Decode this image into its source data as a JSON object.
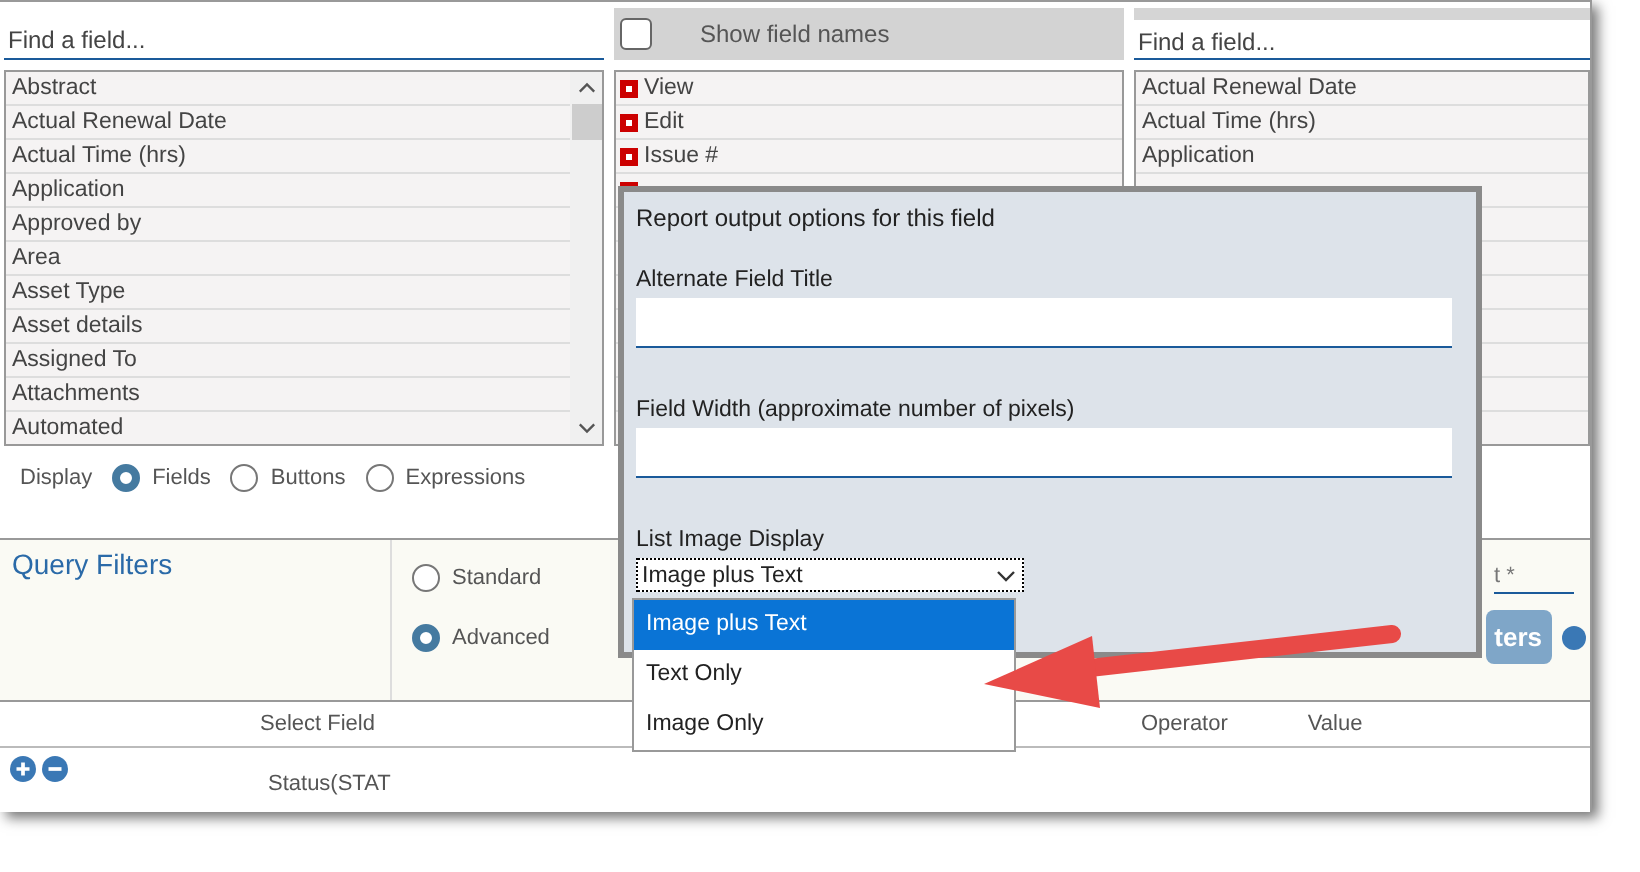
{
  "left_panel": {
    "search": {
      "placeholder": "Find a field..."
    },
    "items": [
      "Abstract",
      "Actual Renewal Date",
      "Actual Time (hrs)",
      "Application",
      "Approved by",
      "Area",
      "Asset Type",
      "Asset details",
      "Assigned To",
      "Attachments",
      "Automated"
    ]
  },
  "middle_panel": {
    "show_field_names": {
      "label": "Show field names",
      "checked": false
    },
    "items": [
      "View",
      "Edit",
      "Issue #"
    ]
  },
  "right_panel": {
    "search": {
      "placeholder": "Find a field..."
    },
    "items": [
      "Actual Renewal Date",
      "Actual Time (hrs)",
      "Application"
    ]
  },
  "display": {
    "label": "Display",
    "options": [
      {
        "label": "Fields",
        "selected": true
      },
      {
        "label": "Buttons",
        "selected": false
      },
      {
        "label": "Expressions",
        "selected": false
      }
    ]
  },
  "query_filters": {
    "title": "Query Filters",
    "modes": [
      {
        "label": "Standard",
        "selected": false
      },
      {
        "label": "Advanced",
        "selected": true
      }
    ],
    "field_fragment": "t *",
    "button_fragment": "ters"
  },
  "table": {
    "columns": [
      "Select Field",
      "Operator",
      "Value"
    ],
    "row": {
      "field": "Status(STAT"
    }
  },
  "popup": {
    "title": "Report output options for this field",
    "fields": [
      {
        "label": "Alternate Field Title"
      },
      {
        "label": "Field Width (approximate number of pixels)"
      }
    ],
    "select": {
      "label": "List Image Display",
      "value": "Image plus Text",
      "options": [
        {
          "label": "Image plus Text",
          "selected": true
        },
        {
          "label": "Text Only",
          "selected": false
        },
        {
          "label": "Image Only",
          "selected": false
        }
      ]
    }
  }
}
